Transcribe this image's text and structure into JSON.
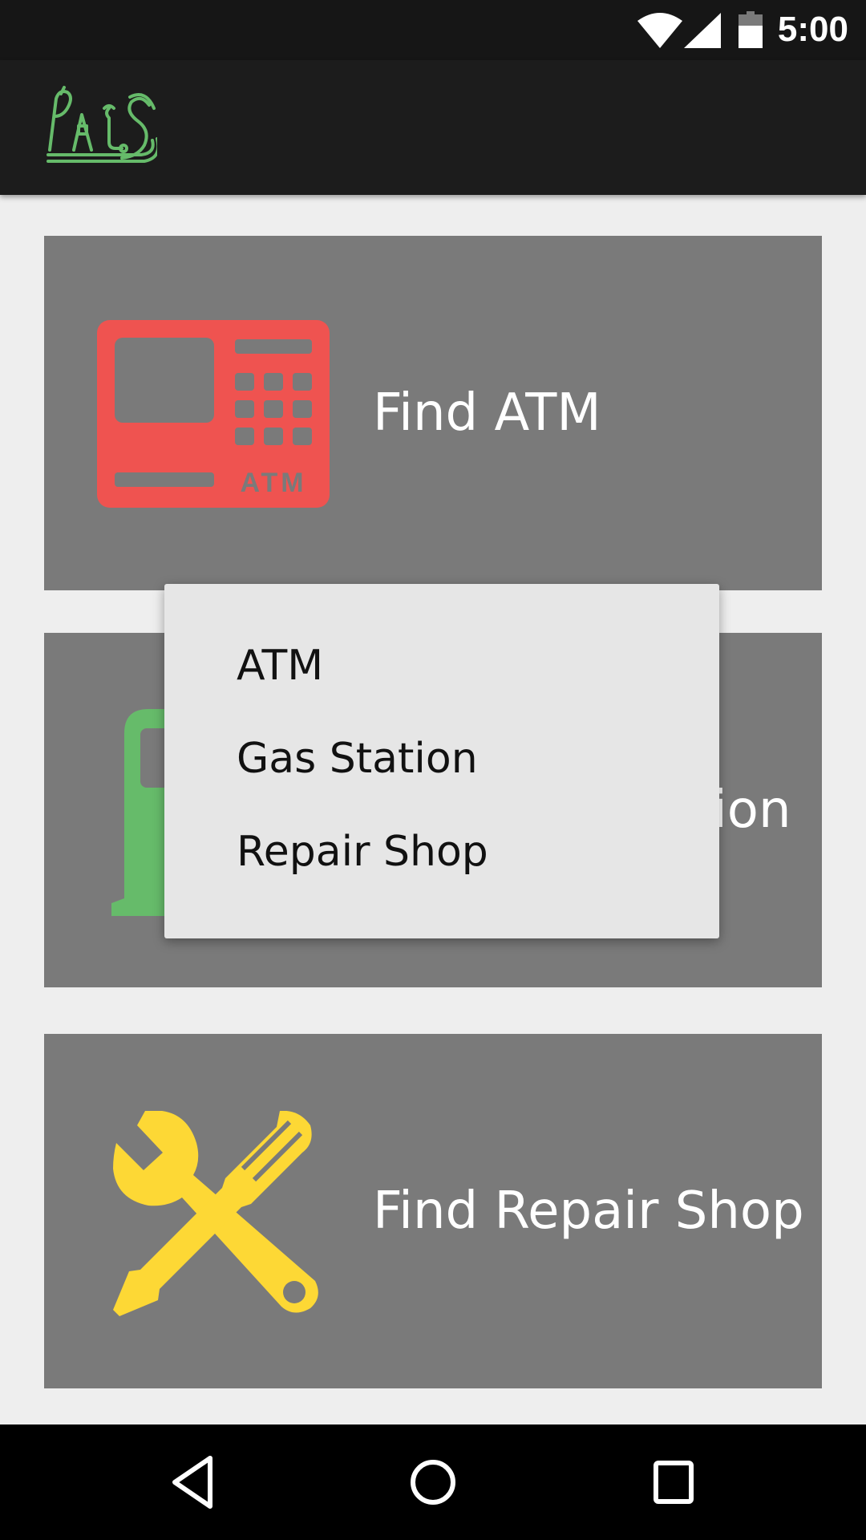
{
  "status_bar": {
    "time": "5:00",
    "icons": [
      "wifi-icon",
      "cellular-signal-icon",
      "battery-icon"
    ]
  },
  "app_bar": {
    "logo_text": "PAIS",
    "logo_color": "#66bb6a"
  },
  "cards": [
    {
      "label": "Find ATM",
      "icon": "atm-icon",
      "icon_color": "#ef5350"
    },
    {
      "label": "Find Gas Station",
      "icon": "gas-pump-icon",
      "icon_color": "#66bb6a"
    },
    {
      "label": "Find Repair Shop",
      "icon": "wrench-screwdriver-icon",
      "icon_color": "#fdd835"
    }
  ],
  "popup_menu": {
    "items": [
      "ATM",
      "Gas Station",
      "Repair Shop"
    ]
  },
  "atm_icon_text": "ATM",
  "nav_bar": {
    "buttons": [
      "back-icon",
      "home-icon",
      "recents-icon"
    ]
  },
  "colors": {
    "card_background": "#7a7a7a",
    "screen_background": "#eeeeee",
    "menu_background": "#e6e6e6",
    "app_bar": "#1c1c1c"
  }
}
